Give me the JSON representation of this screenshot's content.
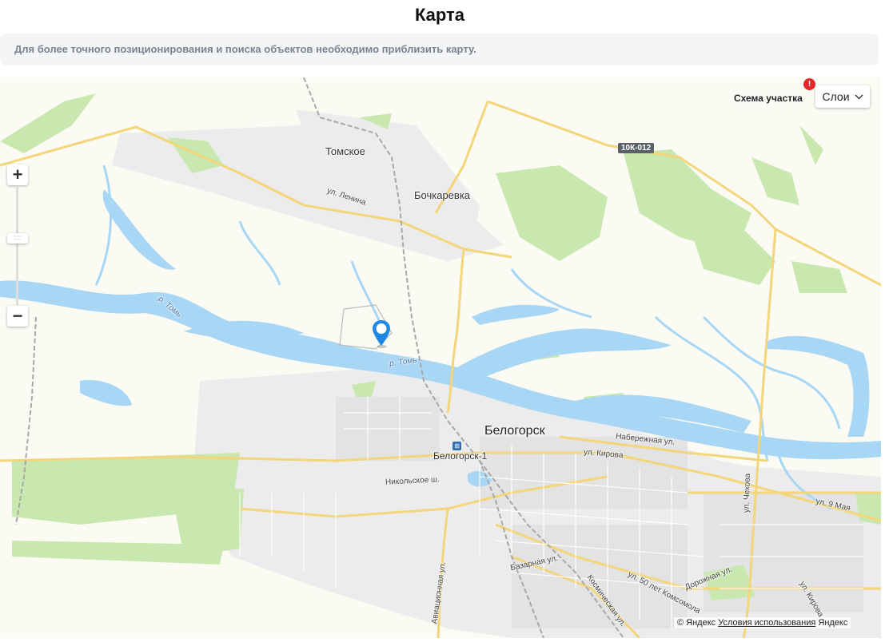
{
  "page": {
    "title": "Карта",
    "notice": "Для более точного позиционирования и поиска объектов необходимо приблизить карту."
  },
  "map": {
    "controls": {
      "zoom_in": "+",
      "zoom_out": "−",
      "layers_label": "Слои",
      "scheme_label": "Схема участка",
      "alert_badge": "!"
    },
    "labels": {
      "tomskoe": "Томское",
      "bochkarevka": "Бочкаревка",
      "lenina": "ул. Ленина",
      "road_badge": "10К-012",
      "river_left": "р. Томь",
      "river_center": "р. Томь",
      "city": "Белогорск",
      "station": "Белогорск-1",
      "naberezhnaya": "Набережная ул.",
      "kirova": "ул. Кирова",
      "nikolskoe": "Никольское ш.",
      "chekhova": "ул. Чехова",
      "may9": "ул. 9 Мая",
      "bazarnaya": "Базарная ул.",
      "aviatsionnaya": "Авиационная ул.",
      "kosmicheskaya": "Космическая ул.",
      "komsomol": "ул. 50 лет Комсомола",
      "dorozhnaya": "Дорожная ул.",
      "kirova2": "ул. Кирова"
    },
    "copyright": {
      "text": "© Яндекс",
      "terms": "Условия использования",
      "brand": "Яндекс"
    },
    "colors": {
      "water": "#a8d6f5",
      "forest": "#c9e8b0",
      "urban": "#ececec",
      "road": "#f3d57a",
      "rail": "#b0b0b0",
      "pin": "#1e88e5"
    }
  }
}
